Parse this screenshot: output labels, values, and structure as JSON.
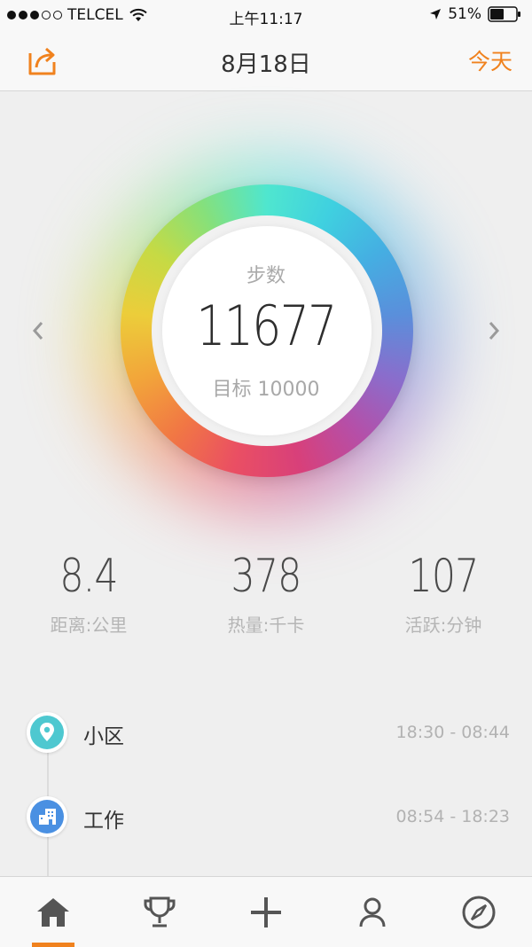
{
  "status_bar": {
    "carrier": "TELCEL",
    "time": "上午11:17",
    "battery": "51%"
  },
  "navbar": {
    "title": "8月18日",
    "today_label": "今天"
  },
  "ring": {
    "label": "步数",
    "value": "11677",
    "goal": "目标 10000",
    "progress": 1.0
  },
  "stats": [
    {
      "value": "8.4",
      "label": "距离:公里"
    },
    {
      "value": "378",
      "label": "热量:千卡"
    },
    {
      "value": "107",
      "label": "活跃:分钟"
    }
  ],
  "timeline": [
    {
      "label": "小区",
      "time": "18:30 - 08:44",
      "icon": "location-pin-icon",
      "color": "#4ec8d0"
    },
    {
      "label": "工作",
      "time": "08:54 - 18:23",
      "icon": "office-building-icon",
      "color": "#4a90e2"
    }
  ],
  "tab_bar": {
    "tabs": [
      "home-icon",
      "trophy-icon",
      "plus-icon",
      "profile-icon",
      "compass-icon"
    ],
    "active_tab": 0
  },
  "colors": {
    "accent": "#f0821e",
    "background": "#efefef",
    "text_primary": "#333333",
    "text_secondary": "#b2b2b2"
  }
}
